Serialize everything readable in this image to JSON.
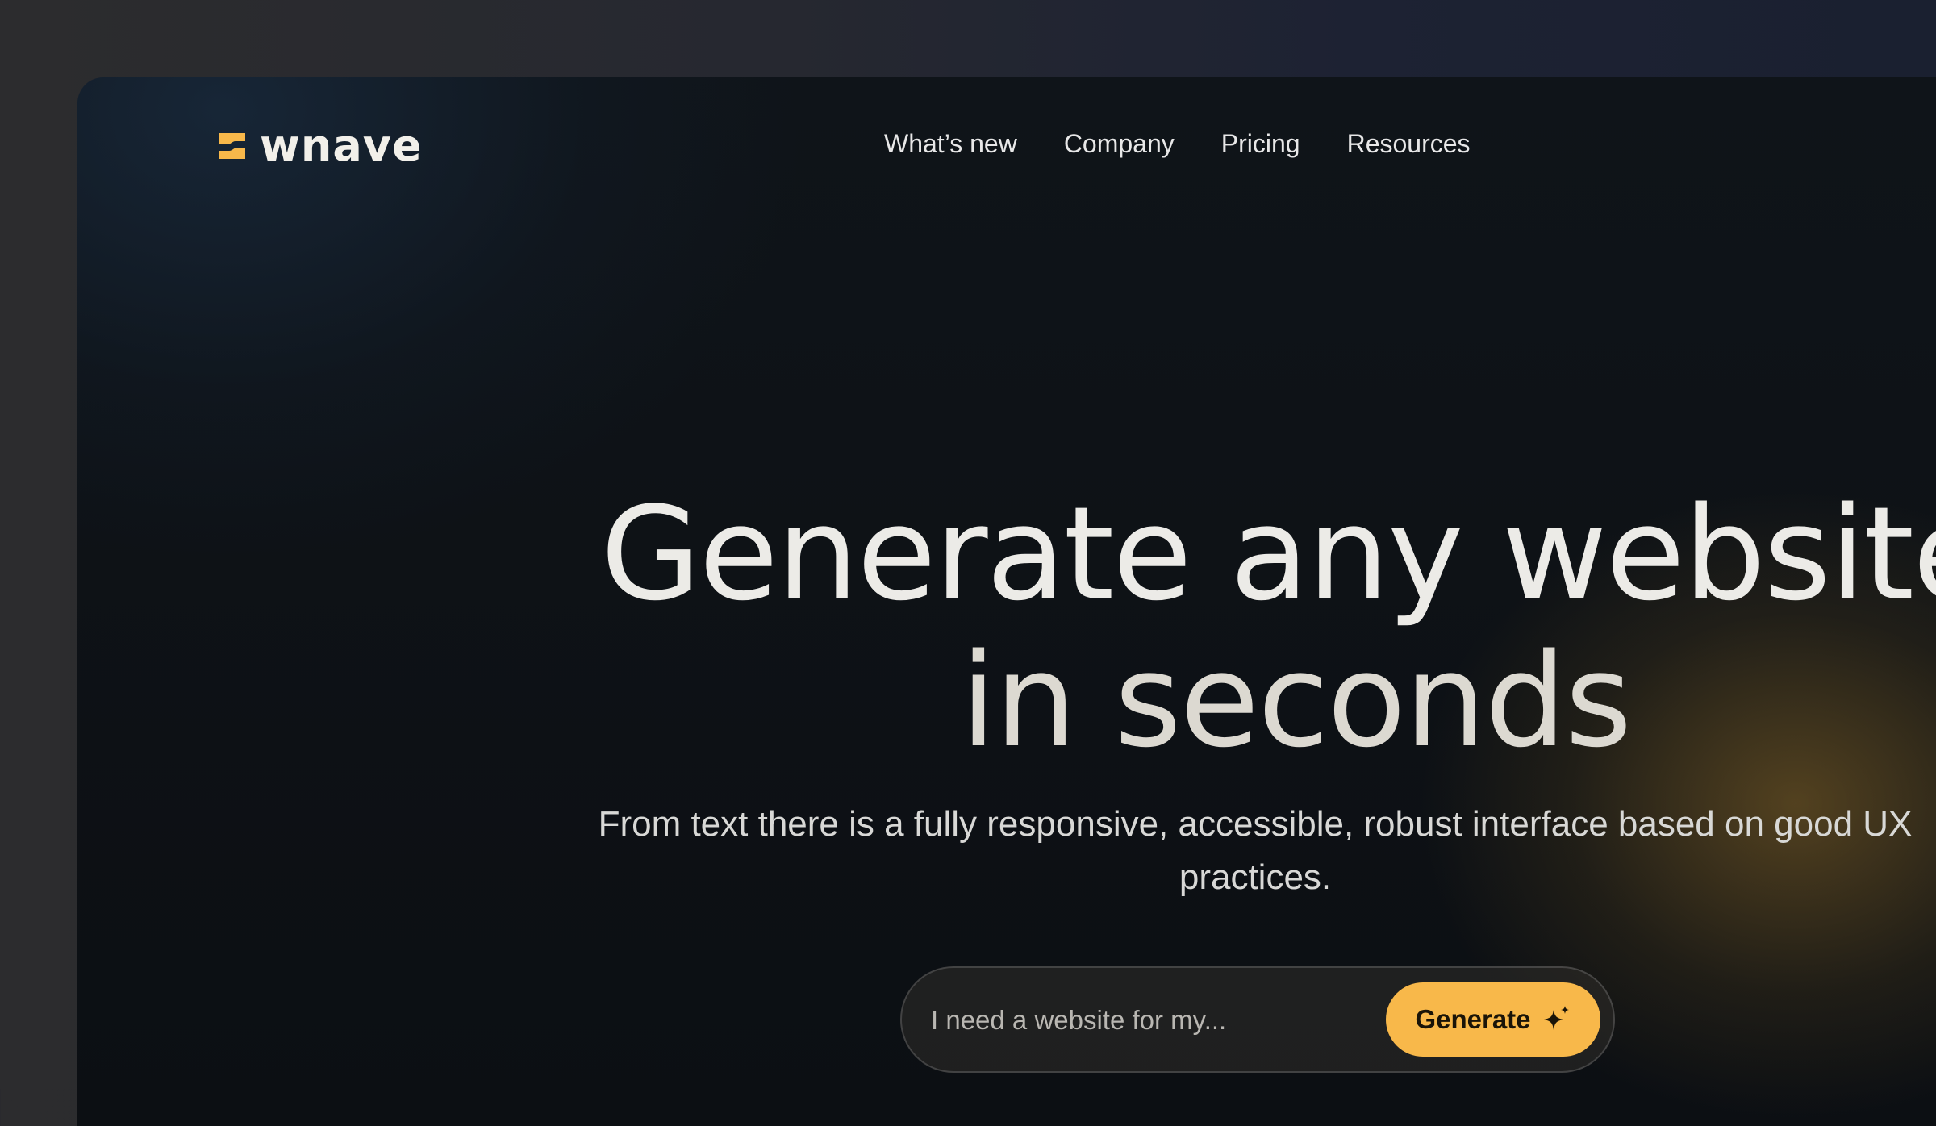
{
  "brand": {
    "name": "wnave",
    "accent_color": "#f8b84a",
    "logo_icon": "s-logo-mark-icon"
  },
  "nav": {
    "items": [
      {
        "label": "What’s new"
      },
      {
        "label": "Company"
      },
      {
        "label": "Pricing"
      },
      {
        "label": "Resources"
      }
    ]
  },
  "hero": {
    "title_line1": "Generate any website",
    "title_line2": "in seconds",
    "subtitle": "From text there is a fully responsive, accessible, robust interface based on good UX practices."
  },
  "prompt": {
    "placeholder": "I need a website for my...",
    "value": "",
    "button_label": "Generate",
    "button_icon": "sparkle-icon"
  }
}
